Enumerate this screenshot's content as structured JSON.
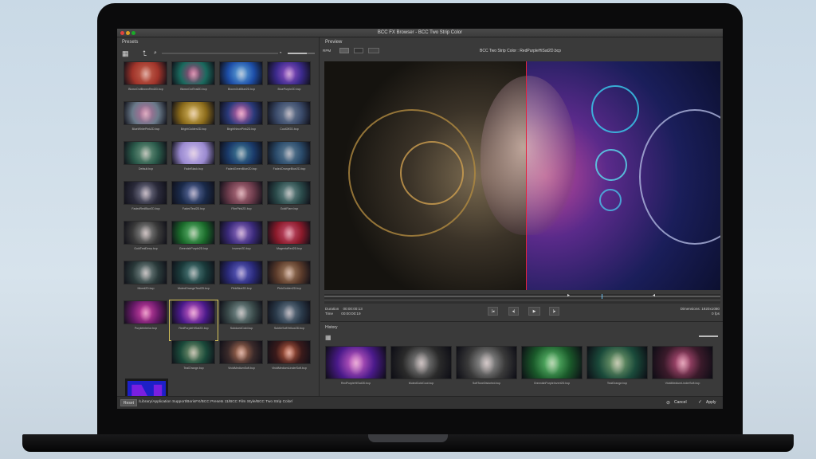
{
  "window": {
    "title": "BCC FX Browser - BCC Two Strip Color"
  },
  "colors": {
    "accent_split": "#e4243b",
    "selection": "#d8c45a",
    "logo_bg": "#1d20c8",
    "logo_fg": "#7a1fe0"
  },
  "presets": {
    "label": "Presets",
    "toolbar_icons": [
      "grid-icon",
      "up-arrow-icon",
      "search-icon",
      "clock-icon"
    ],
    "items": [
      {
        "label": "BlownOutBrownRed2D.bcp",
        "c1": "#a0342a",
        "c2": "#c76a55"
      },
      {
        "label": "BlownOutTeal2D.bcp",
        "c1": "#1a6a5e",
        "c2": "#b83a7a"
      },
      {
        "label": "BlownOutBlue2D.bcp",
        "c1": "#1d4ea8",
        "c2": "#6ab0e0"
      },
      {
        "label": "BluePurple2D.bcp",
        "c1": "#3a2a8a",
        "c2": "#a05ad0"
      },
      {
        "label": "BlueWhitePink2D.bcp",
        "c1": "#6a7a8a",
        "c2": "#c06a9a"
      },
      {
        "label": "BrightGolden2D.bcp",
        "c1": "#8a6a1a",
        "c2": "#e0c06a"
      },
      {
        "label": "BrightNeonPink2D.bcp",
        "c1": "#2a3a7a",
        "c2": "#e06ab0"
      },
      {
        "label": "CoolOff2D.bcp",
        "c1": "#3a4a6a",
        "c2": "#7a8aa0"
      },
      {
        "label": "Default.bcp",
        "c1": "#2a5a4a",
        "c2": "#7aa08a"
      },
      {
        "label": "FadeBlack.bcp",
        "c1": "#9a8ad0",
        "c2": "#d0c0f0"
      },
      {
        "label": "FadedGreenBlue2D.bcp",
        "c1": "#1a3a6a",
        "c2": "#4a8aa0"
      },
      {
        "label": "FadedOrangeBlue2D.bcp",
        "c1": "#2a4a6a",
        "c2": "#6a8aa0"
      },
      {
        "label": "FadedRedBlue2D.bcp",
        "c1": "#2a2a3a",
        "c2": "#8a8aa0"
      },
      {
        "label": "FadedTeal2D.bcp",
        "c1": "#1a2a4a",
        "c2": "#6a7ab0"
      },
      {
        "label": "FilmPink2D.bcp",
        "c1": "#6a3a4a",
        "c2": "#c07a8a"
      },
      {
        "label": "GoldFlare.bcp",
        "c1": "#2a4a4a",
        "c2": "#7a9a9a"
      },
      {
        "label": "GoldTealDeep.bcp",
        "c1": "#3a3a3a",
        "c2": "#9a9a9a"
      },
      {
        "label": "GreenishPurple2D.bcp",
        "c1": "#1a6a2a",
        "c2": "#6ac07a"
      },
      {
        "label": "Inverse2D.bcp",
        "c1": "#3a2a7a",
        "c2": "#a07ad0"
      },
      {
        "label": "MagentaRed2D.bcp",
        "c1": "#8a1a2a",
        "c2": "#d05a7a"
      },
      {
        "label": "Mixed2D.bcp",
        "c1": "#2a3a3a",
        "c2": "#8a9a9a"
      },
      {
        "label": "MutedOrangeTeal2D.bcp",
        "c1": "#1a3a3a",
        "c2": "#5a8a8a"
      },
      {
        "label": "PinkBlue2D.bcp",
        "c1": "#2a2a7a",
        "c2": "#6a6ad0"
      },
      {
        "label": "PinkGolden2D.bcp",
        "c1": "#5a3a2a",
        "c2": "#b08a6a"
      },
      {
        "label": "PurpleInterior.bcp",
        "c1": "#6a1a6a",
        "c2": "#e04ab0"
      },
      {
        "label": "RedPurpleHiSat2D.bcp",
        "c1": "#4a1a8a",
        "c2": "#e06ad0"
      },
      {
        "label": "SubduedCold.bcp",
        "c1": "#3a4a4a",
        "c2": "#8aa0a0"
      },
      {
        "label": "SubtleSoftYellow2D.bcp",
        "c1": "#2a3a4a",
        "c2": "#7a8a9a"
      },
      {
        "label": "",
        "c1": "#1d20c8",
        "c2": "#7a1fe0"
      },
      {
        "label": "TealOrange.bcp",
        "c1": "#1a4a3a",
        "c2": "#8aa07a"
      },
      {
        "label": "VividMediumSoft.bcp",
        "c1": "#3a2a2a",
        "c2": "#c07a5a"
      },
      {
        "label": "VividMediumLinderSoft.bcp",
        "c1": "#3a1a1a",
        "c2": "#d06a4a"
      }
    ]
  },
  "preview": {
    "label": "Preview",
    "toolbar_left": "RPM",
    "title": "BCC Two Strip Color : RedPurpleHiSat2D.bcp",
    "duration_label": "Duration",
    "duration_value": "00:00:00:13",
    "time_label": "Time",
    "time_value": "00:00:00:19",
    "dimensions_label": "Dimensions: 1920x1080",
    "fps_label": "0 fps",
    "transport": [
      "|◂",
      "◂|",
      "▶",
      "|▸"
    ]
  },
  "history": {
    "label": "History",
    "items": [
      {
        "label": "RedPurpleHiSat2D.bcp",
        "c1": "#4a1a8a",
        "c2": "#e06ad0"
      },
      {
        "label": "MutedColdCool.bcp",
        "c1": "#2a2a2a",
        "c2": "#9a9a9a"
      },
      {
        "label": "SoftToneDistorted.bcp",
        "c1": "#3a3a3a",
        "c2": "#aaaaaa"
      },
      {
        "label": "GreenishPurpleInvert2D.bcp",
        "c1": "#1a5a2a",
        "c2": "#6ad07a"
      },
      {
        "label": "TealOrange.bcp",
        "c1": "#1a4a3a",
        "c2": "#8ab07a"
      },
      {
        "label": "VividMediumLinderSoft.bcp",
        "c1": "#3a1a2a",
        "c2": "#d05a8a"
      }
    ]
  },
  "footer": {
    "reset_label": "Reset",
    "path": "/Library/Application Support/BorisFX/BCC Presets 11/BCC Film Style/BCC Two Strip Color/",
    "cancel_label": "Cancel",
    "apply_label": "Apply"
  }
}
